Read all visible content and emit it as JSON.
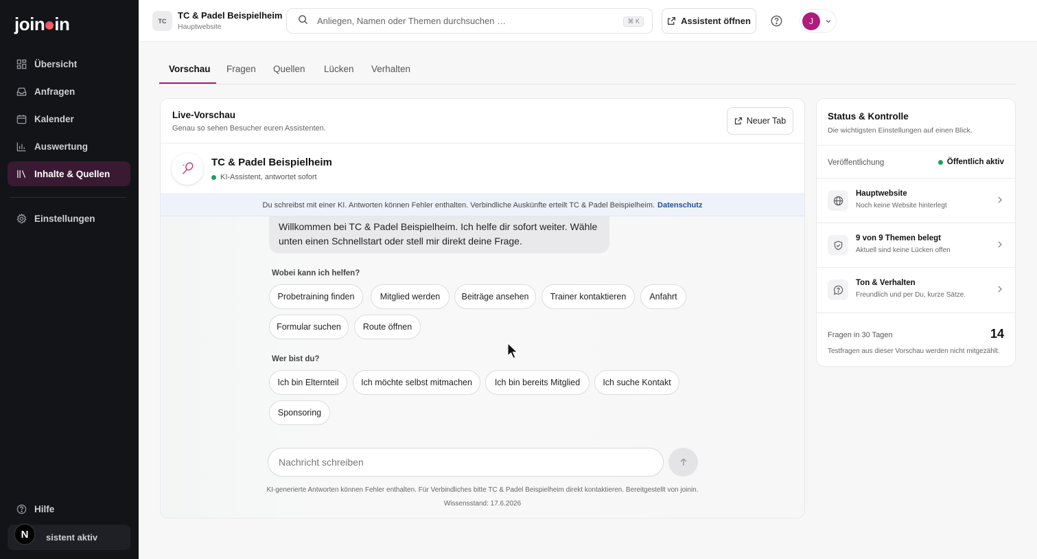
{
  "app": {
    "logo_left": "join",
    "logo_right": "in"
  },
  "sidebar": {
    "items": [
      {
        "label": "Übersicht",
        "icon": "grid-icon"
      },
      {
        "label": "Anfragen",
        "icon": "inbox-icon"
      },
      {
        "label": "Kalender",
        "icon": "calendar-icon"
      },
      {
        "label": "Auswertung",
        "icon": "chart-icon"
      },
      {
        "label": "Inhalte & Quellen",
        "icon": "library-icon",
        "active": true
      },
      {
        "label": "Einstellungen",
        "icon": "gear-icon"
      }
    ],
    "help": "Hilfe",
    "assistant_status": "sistent aktiv",
    "n_badge": "N"
  },
  "header": {
    "org_badge": "TC",
    "org_name": "TC & Padel Beispielheim",
    "org_sub": "Hauptwebsite",
    "search_placeholder": "Anliegen, Namen oder Themen durchsuchen …",
    "shortcut": "⌘ K",
    "open_assistant": "Assistent öffnen",
    "avatar_initial": "J"
  },
  "tabs": [
    "Vorschau",
    "Fragen",
    "Quellen",
    "Lücken",
    "Verhalten"
  ],
  "preview": {
    "title": "Live-Vorschau",
    "subtitle": "Genau so sehen Besucher euren Assistenten.",
    "new_tab": "Neuer Tab",
    "bot_name": "TC & Padel Beispielheim",
    "bot_status": "KI-Assistent, antwortet sofort",
    "notice": "Du schreibst mit einer KI. Antworten können Fehler enthalten. Verbindliche Auskünfte erteilt TC & Padel Beispielheim.",
    "notice_link": "Datenschutz",
    "welcome": "Willkommen bei TC & Padel Beispielheim. Ich helfe dir sofort weiter. Wähle unten einen Schnellstart oder stell mir direkt deine Frage.",
    "help_label": "Wobei kann ich helfen?",
    "help_chips": [
      "Probetraining finden",
      "Mitglied werden",
      "Beiträge ansehen",
      "Trainer kontaktieren",
      "Anfahrt",
      "Formular suchen",
      "Route öffnen"
    ],
    "who_label": "Wer bist du?",
    "who_chips": [
      "Ich bin Elternteil",
      "Ich möchte selbst mitmachen",
      "Ich bin bereits Mitglied",
      "Ich suche Kontakt",
      "Sponsoring"
    ],
    "input_placeholder": "Nachricht schreiben",
    "footer": "KI-generierte Antworten können Fehler enthalten. Für Verbindliches bitte TC & Padel Beispielheim direkt kontaktieren. Bereitgestellt von joinin.",
    "knowledge": "Wissensstand: 17.6.2026"
  },
  "status": {
    "title": "Status & Kontrolle",
    "subtitle": "Die wichtigsten Einstellungen auf einen Blick.",
    "publication_label": "Veröffentlichung",
    "publication_value": "Öffentlich aktiv",
    "items": [
      {
        "title": "Hauptwebsite",
        "sub": "Noch keine Website hinterlegt",
        "icon": "globe-icon"
      },
      {
        "title": "9 von 9 Themen belegt",
        "sub": "Aktuell sind keine Lücken offen",
        "icon": "shield-check-icon"
      },
      {
        "title": "Ton & Verhalten",
        "sub": "Freundlich und per Du, kurze Sätze.",
        "icon": "chat-question-icon"
      }
    ],
    "questions_label": "Fragen in 30 Tagen",
    "questions_value": "14",
    "questions_note": "Testfragen aus dieser Vorschau werden nicht mitgezählt."
  },
  "colors": {
    "accent": "#a8197a",
    "sidebar_bg": "#131418",
    "active_nav": "#3a1a33",
    "status_green": "#1e9e5a"
  }
}
